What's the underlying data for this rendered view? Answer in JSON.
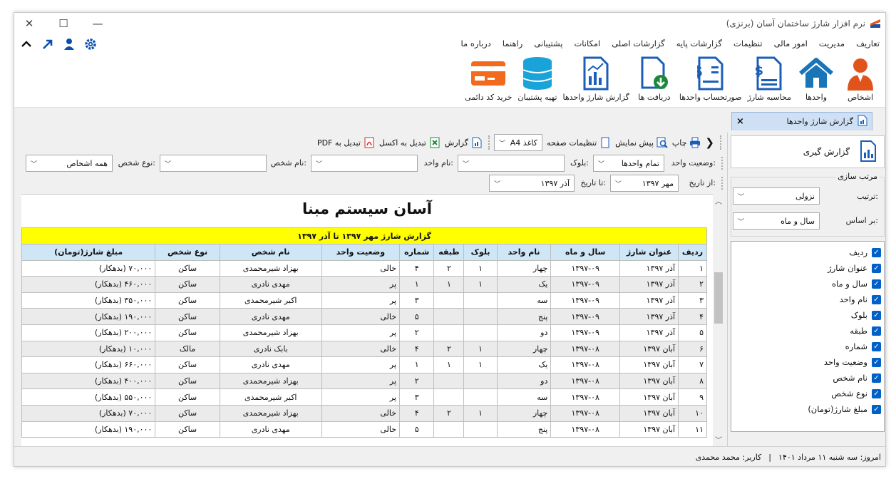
{
  "window": {
    "title": "نرم افزار شارژ ساختمان آسان (برنزی)",
    "accent": "#0a66c8"
  },
  "menu": {
    "items": [
      "تعاریف",
      "مدیریت",
      "امور مالی",
      "تنظیمات",
      "گزارشات پایه",
      "گزارشات اصلی",
      "امکانات",
      "پشتیبانی",
      "راهنما",
      "درباره ما"
    ],
    "icons": [
      "settings-icon",
      "user-icon",
      "arrow-up-right-icon",
      "chevron-up-icon"
    ]
  },
  "ribbon": {
    "buttons": [
      {
        "label": "اشخاص",
        "icon": "person-icon"
      },
      {
        "label": "واحدها",
        "icon": "home-icon"
      },
      {
        "label": "محاسبه شارژ",
        "icon": "invoice-icon"
      },
      {
        "label": "صورتحساب واحدها",
        "icon": "statement-icon"
      },
      {
        "label": "دریافت ها",
        "icon": "download-doc-icon"
      },
      {
        "label": "گزارش شارژ واحدها",
        "icon": "chart-doc-icon"
      },
      {
        "label": "تهیه پشتیبان",
        "icon": "database-icon"
      },
      {
        "label": "خرید کد دائمی",
        "icon": "credit-card-icon"
      }
    ]
  },
  "tab": {
    "label": "گزارش شارژ واحدها",
    "close": "×"
  },
  "toolbar": {
    "nav": "❮",
    "print": "چاپ",
    "preview": "پیش نمایش",
    "page_settings": "تنظیمات صفحه",
    "paper": "کاغذ A4",
    "report": "گزارش",
    "excel": "تبدیل به اکسل",
    "pdf": "تبدیل به PDF"
  },
  "filters": {
    "unit_status_label": "وضعیت واحد:",
    "unit_status_value": "تمام واحدها",
    "block_label": "بلوک:",
    "block_value": "",
    "unit_name_label": "نام واحد:",
    "unit_name_value": "",
    "person_name_label": "نام شخص:",
    "person_name_value": "",
    "person_type_label": "نوع شخص:",
    "person_type_value": "همه اشخاص",
    "from_date_label": "از تاریخ:",
    "from_date_value": "مهر ۱۳۹۷",
    "to_date_label": "تا تاریخ:",
    "to_date_value": "آذر ۱۳۹۷"
  },
  "report": {
    "title": "آسان سیستم مبنا",
    "caption": "گزارش شارژ مهر ۱۳۹۷ تا آذر ۱۳۹۷",
    "columns": [
      "ردیف",
      "عنوان شارژ",
      "سال و ماه",
      "نام واحد",
      "بلوک",
      "طبقه",
      "شماره",
      "وضعیت واحد",
      "نام شخص",
      "نوع شخص",
      "مبلغ شارژ(تومان)"
    ],
    "rows": [
      [
        "۱",
        "آذر ۱۳۹۷",
        "۱۳۹۷-۰۹",
        "چهار",
        "۱",
        "۲",
        "۴",
        "خالی",
        "بهزاد شیرمحمدی",
        "ساکن",
        "۷۰,۰۰۰ (بدهکار)"
      ],
      [
        "۲",
        "آذر ۱۳۹۷",
        "۱۳۹۷-۰۹",
        "یک",
        "۱",
        "۱",
        "۱",
        "پر",
        "مهدی نادری",
        "ساکن",
        "۴۶۰,۰۰۰ (بدهکار)"
      ],
      [
        "۳",
        "آذر ۱۳۹۷",
        "۱۳۹۷-۰۹",
        "سه",
        "",
        "",
        "۳",
        "پر",
        "اکبر شیرمحمدی",
        "ساکن",
        "۳۵۰,۰۰۰ (بدهکار)"
      ],
      [
        "۴",
        "آذر ۱۳۹۷",
        "۱۳۹۷-۰۹",
        "پنج",
        "",
        "",
        "۵",
        "خالی",
        "مهدی نادری",
        "ساکن",
        "۱۹۰,۰۰۰ (بدهکار)"
      ],
      [
        "۵",
        "آذر ۱۳۹۷",
        "۱۳۹۷-۰۹",
        "دو",
        "",
        "",
        "۲",
        "پر",
        "بهزاد شیرمحمدی",
        "ساکن",
        "۲۰۰,۰۰۰ (بدهکار)"
      ],
      [
        "۶",
        "آبان ۱۳۹۷",
        "۱۳۹۷-۰۸",
        "چهار",
        "۱",
        "۲",
        "۴",
        "خالی",
        "بابک نادری",
        "مالک",
        "۱۰,۰۰۰ (بدهکار)"
      ],
      [
        "۷",
        "آبان ۱۳۹۷",
        "۱۳۹۷-۰۸",
        "یک",
        "۱",
        "۱",
        "۱",
        "پر",
        "مهدی نادری",
        "ساکن",
        "۶۶۰,۰۰۰ (بدهکار)"
      ],
      [
        "۸",
        "آبان ۱۳۹۷",
        "۱۳۹۷-۰۸",
        "دو",
        "",
        "",
        "۲",
        "پر",
        "بهزاد شیرمحمدی",
        "ساکن",
        "۴۰۰,۰۰۰ (بدهکار)"
      ],
      [
        "۹",
        "آبان ۱۳۹۷",
        "۱۳۹۷-۰۸",
        "سه",
        "",
        "",
        "۳",
        "پر",
        "اکبر شیرمحمدی",
        "ساکن",
        "۵۵۰,۰۰۰ (بدهکار)"
      ],
      [
        "۱۰",
        "آبان ۱۳۹۷",
        "۱۳۹۷-۰۸",
        "چهار",
        "۱",
        "۲",
        "۴",
        "خالی",
        "بهزاد شیرمحمدی",
        "ساکن",
        "۷۰,۰۰۰ (بدهکار)"
      ],
      [
        "۱۱",
        "آبان ۱۳۹۷",
        "۱۳۹۷-۰۸",
        "پنج",
        "",
        "",
        "۵",
        "خالی",
        "مهدی نادری",
        "ساکن",
        "۱۹۰,۰۰۰ (بدهکار)"
      ]
    ]
  },
  "side": {
    "report_button": "گزارش گیری",
    "sort_group": "مرتب سازی",
    "order_label": "ترتیب:",
    "order_value": "نزولی",
    "basis_label": "بر اساس:",
    "basis_value": "سال و ماه",
    "columns": [
      "ردیف",
      "عنوان شارژ",
      "سال و ماه",
      "نام واحد",
      "بلوک",
      "طبقه",
      "شماره",
      "وضعیت واحد",
      "نام شخص",
      "نوع شخص",
      "مبلغ شارژ(تومان)"
    ]
  },
  "status": {
    "today": "امروز: سه شنبه ۱۱ مرداد ۱۴۰۱",
    "sep": "|",
    "user": "کاربر: محمد محمدی"
  }
}
